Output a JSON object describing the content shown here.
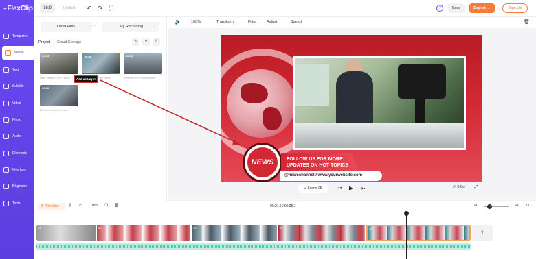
{
  "brand": {
    "name": "FlexClip",
    "accent": "#6a49f2",
    "orange": "#f27d3a"
  },
  "topbar": {
    "ratio": "16:9",
    "title": "Untitled",
    "save_label": "Save",
    "export_label": "Export →",
    "signup_label": "Sign Up"
  },
  "sidebar": {
    "items": [
      {
        "label": "Templates",
        "icon": "templates-icon"
      },
      {
        "label": "Media",
        "icon": "media-icon"
      },
      {
        "label": "Text",
        "icon": "text-icon"
      },
      {
        "label": "Subtitle",
        "icon": "subtitle-icon"
      },
      {
        "label": "Video",
        "icon": "video-icon"
      },
      {
        "label": "Photo",
        "icon": "photo-icon"
      },
      {
        "label": "Audio",
        "icon": "audio-icon"
      },
      {
        "label": "Elements",
        "icon": "elements-icon"
      },
      {
        "label": "Overlays",
        "icon": "overlays-icon"
      },
      {
        "label": "BKground",
        "icon": "background-icon"
      },
      {
        "label": "Tools",
        "icon": "tools-icon"
      }
    ]
  },
  "media": {
    "local_files": "Local Files",
    "folder": "My Recording",
    "tabs": [
      "Project",
      "Cloud Storage"
    ],
    "items": [
      {
        "duration": "00:19",
        "caption": "Reel footing in Sri Lanka"
      },
      {
        "duration": "00:38",
        "caption": "man reporting the news"
      },
      {
        "duration": "00:16",
        "caption": "Aerinets on a construction"
      },
      {
        "duration": "00:06",
        "caption": "Medium shot of female"
      }
    ],
    "tooltip": "Add as Layer"
  },
  "preview": {
    "zoom": "100%",
    "tools": [
      "Transform",
      "Filter",
      "Adjust",
      "Speed"
    ],
    "news_badge": "NEWS",
    "follow_text": "FOLLOW US FOR MORE UPDATES ON HOT TOPICS",
    "handle_text": "@newschannel / www.yourwebsite.com",
    "scene_label": "Scene 05",
    "scene_duration": "6.0s"
  },
  "timeline": {
    "label": "Timeline",
    "trim_label": "Trim",
    "time": "00:21.5 / 00:25.1",
    "clip_markers": [
      "01",
      "02",
      "03",
      "04",
      "05"
    ]
  }
}
